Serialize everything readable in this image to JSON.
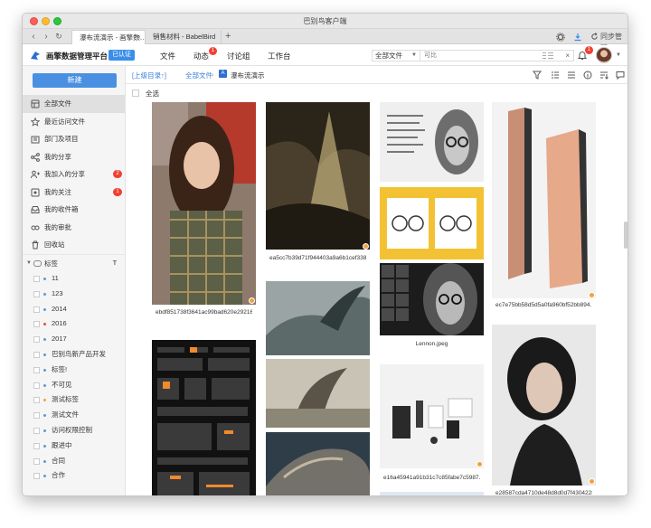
{
  "window": {
    "title": "巴别鸟客户端"
  },
  "tabs": [
    {
      "label": "瀑布流演示 - 画擎数…"
    },
    {
      "label": "销售材料 - BabelBird"
    }
  ],
  "tabbar_right": {
    "sync_label": "同步管理"
  },
  "app": {
    "brand": "画擎数据管理平台",
    "verified": "已认证",
    "menu": [
      {
        "label": "文件"
      },
      {
        "label": "动态",
        "badge": "1"
      },
      {
        "label": "讨论组"
      },
      {
        "label": "工作台"
      }
    ],
    "scope": "全部文件",
    "search_placeholder": "可比",
    "bell_badge": "1"
  },
  "sidebar": {
    "new_button": "新建",
    "items": [
      {
        "label": "全部文件",
        "icon": "all-files-icon",
        "active": true
      },
      {
        "label": "最近访问文件",
        "icon": "star-icon"
      },
      {
        "label": "部门及项目",
        "icon": "department-icon"
      },
      {
        "label": "我的分享",
        "icon": "share-icon"
      },
      {
        "label": "我加入的分享",
        "icon": "joined-share-icon",
        "badge": "2"
      },
      {
        "label": "我的关注",
        "icon": "follow-icon",
        "badge": "1"
      },
      {
        "label": "我的收件箱",
        "icon": "inbox-icon"
      },
      {
        "label": "我的审批",
        "icon": "approval-icon"
      },
      {
        "label": "回收站",
        "icon": "trash-icon"
      }
    ],
    "tags_header": "标签",
    "tags": [
      {
        "label": "11",
        "color": "#5b9bd5"
      },
      {
        "label": "123",
        "color": "#5b9bd5"
      },
      {
        "label": "2014",
        "color": "#5b9bd5"
      },
      {
        "label": "2016",
        "color": "#e0533c"
      },
      {
        "label": "2017",
        "color": "#5b9bd5"
      },
      {
        "label": "巴别鸟新产品开发",
        "color": "#5b9bd5"
      },
      {
        "label": "标签!",
        "color": "#5b9bd5"
      },
      {
        "label": "不可见",
        "color": "#5b9bd5"
      },
      {
        "label": "测试标签",
        "color": "#f0a33c"
      },
      {
        "label": "测试文件",
        "color": "#5b9bd5"
      },
      {
        "label": "访问权限控制",
        "color": "#5b9bd5"
      },
      {
        "label": "跟进中",
        "color": "#5b9bd5"
      },
      {
        "label": "合同",
        "color": "#5b9bd5"
      },
      {
        "label": "合作",
        "color": "#5b9bd5"
      }
    ]
  },
  "breadcrumb": {
    "up": "[上级目录↑]",
    "root": "全部文件",
    "current": "瀑布流演示"
  },
  "select_all": "全选",
  "gallery": [
    {
      "caption": "ebdf851738f3641ac99bad620e29216f…"
    },
    {
      "caption": ""
    },
    {
      "caption": "ea5cc7b39d71f944403a9a6b1cef3389…"
    },
    {
      "caption": ""
    },
    {
      "caption": ""
    },
    {
      "caption": ""
    },
    {
      "caption": ""
    },
    {
      "caption": ""
    },
    {
      "caption": "Lennon.jpeg"
    },
    {
      "caption": "e16a45941a91b31c7c85fabe7c5987…"
    },
    {
      "caption": ""
    },
    {
      "caption": "ec7e75bb58d5d5a0fa960bf52bb894…"
    },
    {
      "caption": "e28587cda4710de48d8d0d7f4304228…"
    }
  ],
  "colors": {
    "accent": "#4a90e2",
    "badge": "#f04134",
    "link": "#3b7dd8"
  }
}
